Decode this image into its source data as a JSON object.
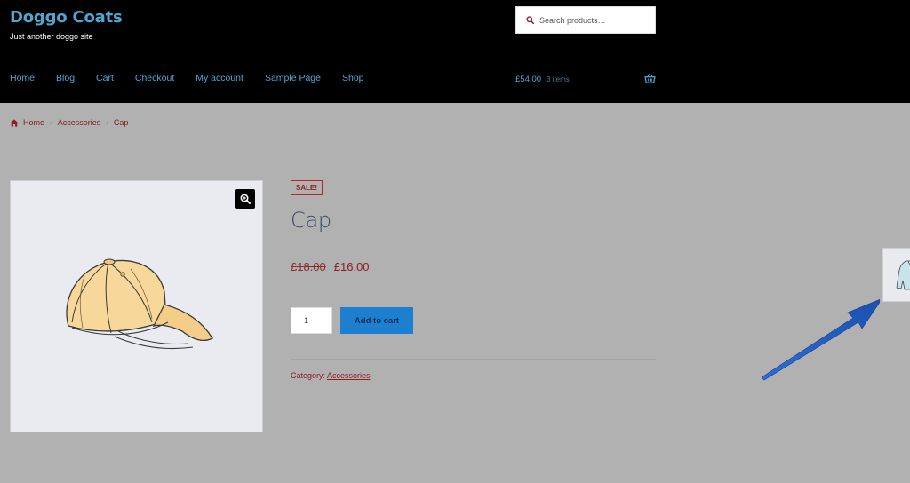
{
  "header": {
    "site_title": "Doggo Coats",
    "tagline": "Just another doggo site",
    "search_placeholder": "Search products…",
    "nav": [
      "Home",
      "Blog",
      "Cart",
      "Checkout",
      "My account",
      "Sample Page",
      "Shop"
    ],
    "cart_total": "£54.00",
    "cart_count": "3 items"
  },
  "breadcrumb": [
    "Home",
    "Accessories",
    "Cap"
  ],
  "product": {
    "sale_badge": "SALE!",
    "title": "Cap",
    "price_old": "£18.00",
    "price_new": "£16.00",
    "quantity": "1",
    "add_to_cart_label": "Add to cart",
    "category_label": "Category:",
    "category_value": "Accessories"
  },
  "icons": {
    "search": "search-icon",
    "basket": "basket-icon",
    "home": "home-icon",
    "zoom": "zoom-in-icon"
  },
  "colors": {
    "header_bg": "#000000",
    "link_blue": "#4fa6d3",
    "accent_red": "#8c1f22",
    "button_blue": "#1d7fd0",
    "page_bg": "#b1b1b1",
    "arrow_blue": "#1f5fc8"
  }
}
